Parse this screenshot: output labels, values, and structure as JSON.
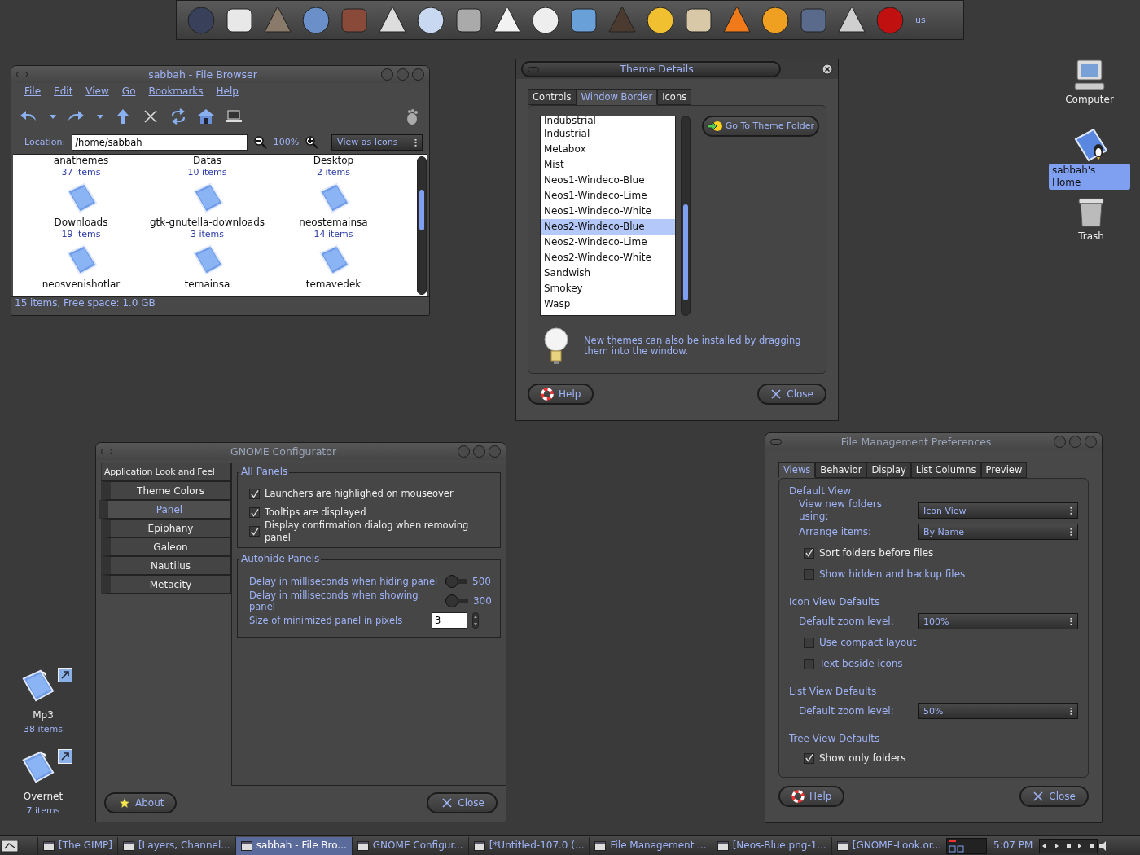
{
  "dock": {
    "layout_label": "us"
  },
  "desktop_right": [
    {
      "label": "Computer",
      "selected": false,
      "kind": "computer"
    },
    {
      "label": "sabbah's Home",
      "selected": true,
      "kind": "home"
    },
    {
      "label": "Trash",
      "selected": false,
      "kind": "trash"
    }
  ],
  "desktop_left": [
    {
      "label": "Mp3",
      "count": "38 items"
    },
    {
      "label": "Overnet",
      "count": "7 items"
    }
  ],
  "file_browser": {
    "title": "sabbah - File Browser",
    "menu": [
      "File",
      "Edit",
      "View",
      "Go",
      "Bookmarks",
      "Help"
    ],
    "location_label": "Location:",
    "location": "/home/sabbah",
    "zoom": "100%",
    "view_mode": "View as Icons",
    "items": [
      {
        "name": "anathemes",
        "count": "37 items",
        "icon_shown": false
      },
      {
        "name": "Datas",
        "count": "10 items",
        "icon_shown": false
      },
      {
        "name": "Desktop",
        "count": "2 items",
        "icon_shown": false
      },
      {
        "name": "Downloads",
        "count": "19 items",
        "icon_shown": true
      },
      {
        "name": "gtk-gnutella-downloads",
        "count": "3 items",
        "icon_shown": true
      },
      {
        "name": "neostemainsa",
        "count": "14 items",
        "icon_shown": true
      },
      {
        "name": "neosvenishotlar",
        "icon_shown": true
      },
      {
        "name": "temainsa",
        "icon_shown": true
      },
      {
        "name": "temavedek",
        "icon_shown": true
      }
    ],
    "status": "15 items, Free space: 1.0 GB"
  },
  "theme_details": {
    "title": "Theme Details",
    "tabs": [
      {
        "label": "Controls",
        "selected": false
      },
      {
        "label": "Window Border",
        "selected": true
      },
      {
        "label": "Icons",
        "selected": false
      }
    ],
    "themes": [
      {
        "name": "Indubstrial",
        "selected": false
      },
      {
        "name": "Industrial",
        "selected": false
      },
      {
        "name": "Metabox",
        "selected": false
      },
      {
        "name": "Mist",
        "selected": false
      },
      {
        "name": "Neos1-Windeco-Blue",
        "selected": false
      },
      {
        "name": "Neos1-Windeco-Lime",
        "selected": false
      },
      {
        "name": "Neos1-Windeco-White",
        "selected": false
      },
      {
        "name": "Neos2-Windeco-Blue",
        "selected": true
      },
      {
        "name": "Neos2-Windeco-Lime",
        "selected": false
      },
      {
        "name": "Neos2-Windeco-White",
        "selected": false
      },
      {
        "name": "Sandwish",
        "selected": false
      },
      {
        "name": "Smokey",
        "selected": false
      },
      {
        "name": "Wasp",
        "selected": false
      }
    ],
    "folder_button": "Go To Theme Folder",
    "hint": "New themes can also be installed by dragging them into the window.",
    "buttons": [
      {
        "label": "Help",
        "kind": "help"
      },
      {
        "label": "Close",
        "kind": "close"
      }
    ]
  },
  "configurator": {
    "title": "GNOME Configurator",
    "sidebar": [
      {
        "label": "Application Look and Feel",
        "kind": "header",
        "selected": false
      },
      {
        "label": "Theme Colors",
        "kind": "item",
        "selected": false
      },
      {
        "label": "Panel",
        "kind": "item",
        "selected": true
      },
      {
        "label": "Epiphany",
        "kind": "item",
        "selected": false
      },
      {
        "label": "Galeon",
        "kind": "item",
        "selected": false
      },
      {
        "label": "Nautilus",
        "kind": "item",
        "selected": false
      },
      {
        "label": "Metacity",
        "kind": "item",
        "selected": false
      }
    ],
    "groups": [
      {
        "title": "All Panels",
        "rows": [
          {
            "kind": "check",
            "label": "Launchers are highlighed on mouseover",
            "checked": true
          },
          {
            "kind": "check",
            "label": "Tooltips are displayed",
            "checked": true
          },
          {
            "kind": "check",
            "label": "Display confirmation dialog when removing panel",
            "checked": true
          }
        ]
      },
      {
        "title": "Autohide Panels",
        "rows": [
          {
            "kind": "slider",
            "label": "Delay in milliseconds when hiding panel",
            "value": "500",
            "level": 0.05
          },
          {
            "kind": "slider",
            "label": "Delay in milliseconds when showing panel",
            "value": "300",
            "level": 0.03
          },
          {
            "kind": "spin",
            "label": "Size of minimized panel in pixels",
            "value": "3"
          }
        ]
      }
    ],
    "buttons": [
      {
        "label": "About",
        "kind": "about"
      },
      {
        "label": "Close",
        "kind": "close"
      }
    ]
  },
  "file_prefs": {
    "title": "File Management Preferences",
    "tabs": [
      {
        "label": "Views",
        "selected": true
      },
      {
        "label": "Behavior",
        "selected": false
      },
      {
        "label": "Display",
        "selected": false
      },
      {
        "label": "List Columns",
        "selected": false
      },
      {
        "label": "Preview",
        "selected": false
      }
    ],
    "sections": [
      {
        "title": "Default View",
        "rows": [
          {
            "kind": "select",
            "label": "View new folders using:",
            "value": "Icon View"
          },
          {
            "kind": "select",
            "label": "Arrange items:",
            "value": "By Name"
          },
          {
            "kind": "check",
            "label": "Sort folders before files",
            "checked": true
          },
          {
            "kind": "check",
            "label": "Show hidden and backup files",
            "checked": false
          }
        ]
      },
      {
        "title": "Icon View Defaults",
        "rows": [
          {
            "kind": "select",
            "label": "Default zoom level:",
            "value": "100%"
          },
          {
            "kind": "check",
            "label": "Use compact layout",
            "checked": false
          },
          {
            "kind": "check",
            "label": "Text beside icons",
            "checked": false
          }
        ]
      },
      {
        "title": "List View Defaults",
        "rows": [
          {
            "kind": "select",
            "label": "Default zoom level:",
            "value": "50%"
          }
        ]
      },
      {
        "title": "Tree View Defaults",
        "rows": [
          {
            "kind": "check",
            "label": "Show only folders",
            "checked": true
          }
        ]
      }
    ],
    "buttons": [
      {
        "label": "Help",
        "kind": "help"
      },
      {
        "label": "Close",
        "kind": "close"
      }
    ]
  },
  "taskbar": {
    "tasks": [
      {
        "label": "[The GIMP]",
        "selected": false
      },
      {
        "label": "[Layers, Channel...",
        "selected": false
      },
      {
        "label": "sabbah - File Bro...",
        "selected": true
      },
      {
        "label": "GNOME Configur...",
        "selected": false
      },
      {
        "label": "[*Untitled-107.0 (...",
        "selected": false
      },
      {
        "label": "File Management ...",
        "selected": false
      },
      {
        "label": "[Neos-Blue.png-1...",
        "selected": false
      },
      {
        "label": "[GNOME-Look.or...",
        "selected": false
      }
    ],
    "clock": "5:07 PM"
  }
}
